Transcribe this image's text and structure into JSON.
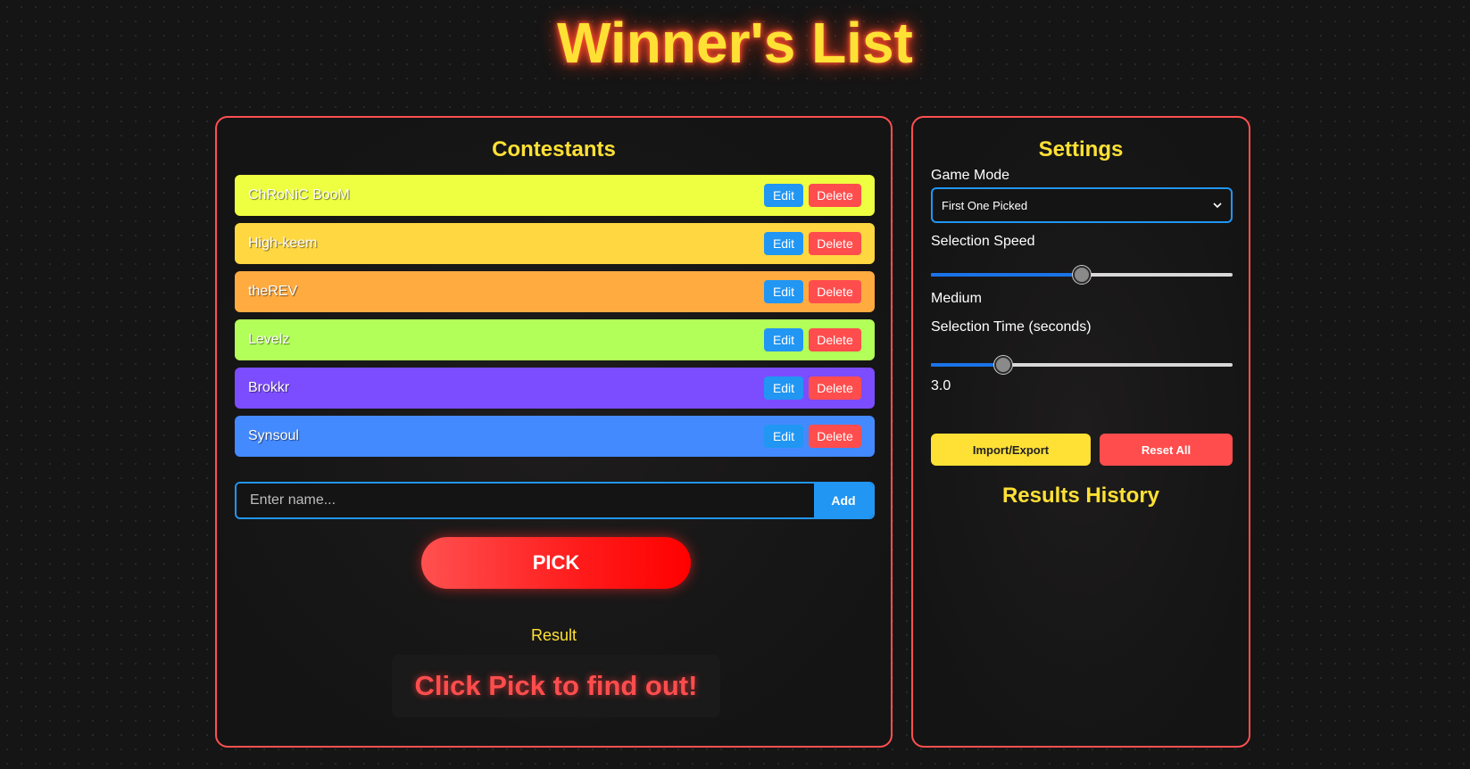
{
  "app": {
    "title": "Winner's List"
  },
  "contestants_panel": {
    "title": "Contestants",
    "edit_label": "Edit",
    "delete_label": "Delete",
    "items": [
      {
        "name": "ChRoNiC BooM",
        "color": "#eeff41"
      },
      {
        "name": "High-keem",
        "color": "#ffd740"
      },
      {
        "name": "theREV",
        "color": "#ffab40"
      },
      {
        "name": "Levelz",
        "color": "#b2ff59"
      },
      {
        "name": "Brokkr",
        "color": "#7c4dff"
      },
      {
        "name": "Synsoul",
        "color": "#448aff"
      }
    ],
    "name_input_placeholder": "Enter name...",
    "name_input_value": "",
    "add_label": "Add",
    "pick_label": "PICK",
    "result_label": "Result",
    "result_text": "Click Pick to find out!"
  },
  "settings_panel": {
    "title": "Settings",
    "game_mode_label": "Game Mode",
    "game_mode_value": "First One Picked",
    "selection_speed_label": "Selection Speed",
    "selection_speed_fraction": 0.5,
    "selection_speed_value": "Medium",
    "selection_time_label": "Selection Time (seconds)",
    "selection_time_fraction": 0.24,
    "selection_time_value": "3.0",
    "import_export_label": "Import/Export",
    "reset_all_label": "Reset All",
    "results_history_title": "Results History"
  },
  "colors": {
    "accent_yellow": "#ffe135",
    "accent_red": "#ff4d4d",
    "accent_blue": "#2196f3",
    "panel_border": "#ff5050"
  }
}
